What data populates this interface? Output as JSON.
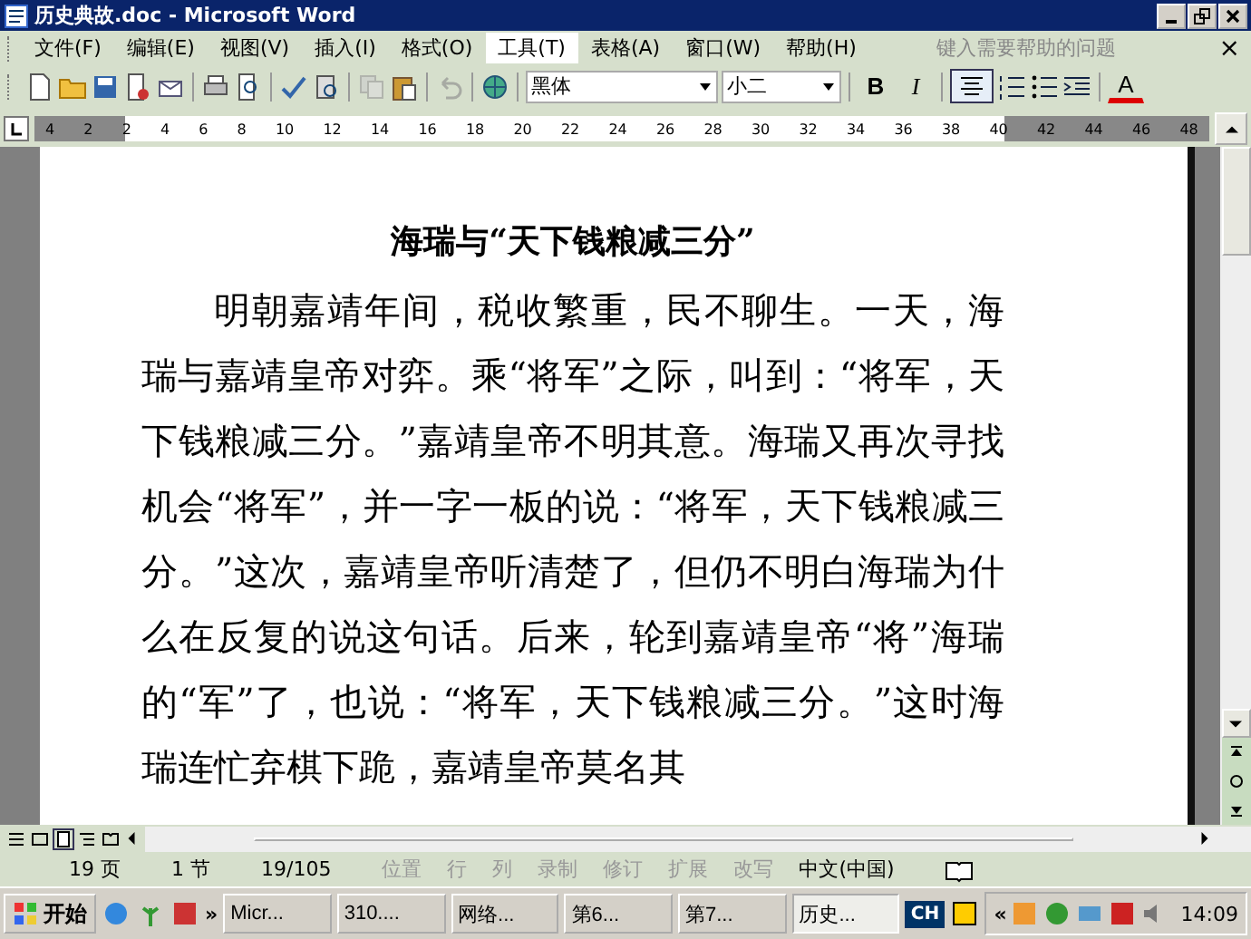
{
  "window": {
    "title": "历史典故.doc - Microsoft Word"
  },
  "menu": {
    "items": [
      {
        "label": "文件(F)",
        "selected": false
      },
      {
        "label": "编辑(E)",
        "selected": false
      },
      {
        "label": "视图(V)",
        "selected": false
      },
      {
        "label": "插入(I)",
        "selected": false
      },
      {
        "label": "格式(O)",
        "selected": false
      },
      {
        "label": "工具(T)",
        "selected": true
      },
      {
        "label": "表格(A)",
        "selected": false
      },
      {
        "label": "窗口(W)",
        "selected": false
      },
      {
        "label": "帮助(H)",
        "selected": false
      }
    ],
    "help_placeholder": "键入需要帮助的问题",
    "close": "×"
  },
  "format_toolbar": {
    "font": "黑体",
    "size": "小二",
    "bold": "B",
    "italic": "I",
    "font_color": "A",
    "center_aligned": true
  },
  "ruler": {
    "ticks": [
      "4",
      "2",
      "2",
      "4",
      "6",
      "8",
      "10",
      "12",
      "14",
      "16",
      "18",
      "20",
      "22",
      "24",
      "26",
      "28",
      "30",
      "32",
      "34",
      "36",
      "38",
      "40",
      "42",
      "44",
      "46",
      "48"
    ]
  },
  "document": {
    "heading": "海瑞与“天下钱粮减三分”",
    "paragraph": "明朝嘉靖年间，税收繁重，民不聊生。一天，海瑞与嘉靖皇帝对弈。乘“将军”之际，叫到：“将军，天下钱粮减三分。”嘉靖皇帝不明其意。海瑞又再次寻找机会“将军”，并一字一板的说：“将军，天下钱粮减三分。”这次，嘉靖皇帝听清楚了，但仍不明白海瑞为什么在反复的说这句话。后来，轮到嘉靖皇帝“将”海瑞的“军”了，也说：“将军，天下钱粮减三分。”这时海瑞连忙弃棋下跪，嘉靖皇帝莫名其"
  },
  "status_bar": {
    "items": [
      {
        "label": "19 页",
        "disabled": false
      },
      {
        "label": "1 节",
        "disabled": false
      },
      {
        "label": "19/105",
        "disabled": false
      },
      {
        "label": "位置",
        "disabled": true
      },
      {
        "label": "行",
        "disabled": true
      },
      {
        "label": "列",
        "disabled": true
      },
      {
        "label": "录制",
        "disabled": true
      },
      {
        "label": "修订",
        "disabled": true
      },
      {
        "label": "扩展",
        "disabled": true
      },
      {
        "label": "改写",
        "disabled": true
      },
      {
        "label": "中文(中国)",
        "disabled": false
      }
    ]
  },
  "taskbar": {
    "start": "开始",
    "more": "»",
    "tasks": [
      {
        "label": "Micr...",
        "selected": false
      },
      {
        "label": "310....",
        "selected": false
      },
      {
        "label": "网络...",
        "selected": false
      },
      {
        "label": "第6...",
        "selected": false
      },
      {
        "label": "第7...",
        "selected": false
      },
      {
        "label": "历史...",
        "selected": true
      }
    ],
    "language": "CH",
    "tray_expand": "«",
    "clock": "14:09"
  }
}
